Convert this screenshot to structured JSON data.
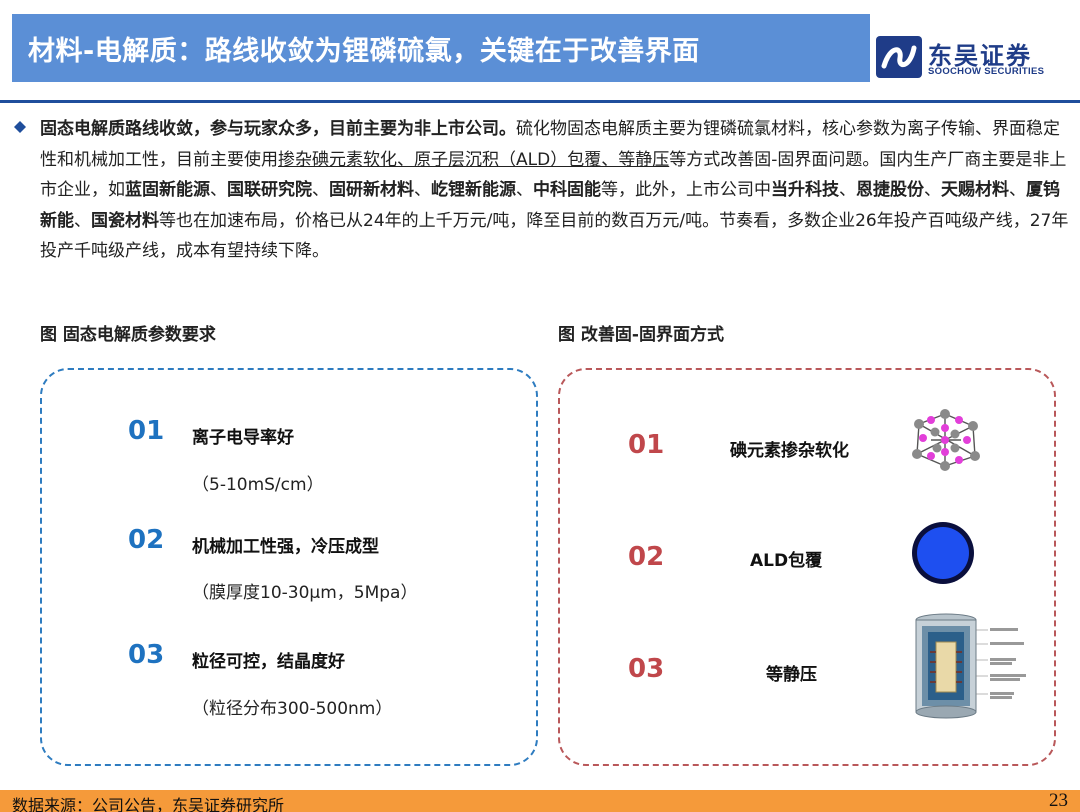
{
  "header": {
    "title": "材料-电解质：路线收敛为锂磷硫氯，关键在于改善界面",
    "logo_cn": "东吴证券",
    "logo_en": "SOOCHOW SECURITIES"
  },
  "summary": {
    "lead_bold": "固态电解质路线收敛，参与玩家众多，目前主要为非上市公司。",
    "text1": "硫化物固态电解质主要为锂磷硫氯材料，核心参数为离子传输、界面稳定性和机械加工性，目前主要使用",
    "underlined": "掺杂碘元素软化、原子层沉积（ALD）包覆、等静压",
    "text2": "等方式改善固-固界面问题。国内生产厂商主要是非上市企业，如",
    "private_companies": [
      "蓝固新能源",
      "国联研究院",
      "固研新材料",
      "屹锂新能源",
      "中科固能"
    ],
    "sep": "、",
    "text3": "等，此外，上市公司中",
    "listed_companies": [
      "当升科技",
      "恩捷股份",
      "天赐材料",
      "厦钨新能",
      "国瓷材料"
    ],
    "text4": "等也在加速布局，价格已从24年的上千万元/吨，降至目前的数百万元/吨。节奏看，多数企业26年投产百吨级产线，27年投产千吨级产线，成本有望持续下降。"
  },
  "figure_left": {
    "caption": "图 固态电解质参数要求",
    "items": [
      {
        "num": "01",
        "title": "离子电导率好",
        "sub": "（5-10mS/cm）"
      },
      {
        "num": "02",
        "title": "机械加工性强，冷压成型",
        "sub": "（膜厚度10-30μm，5Mpa）"
      },
      {
        "num": "03",
        "title": "粒径可控，结晶度好",
        "sub": "（粒径分布300-500nm）"
      }
    ]
  },
  "figure_right": {
    "caption": "图 改善固-固界面方式",
    "items": [
      {
        "num": "01",
        "title": "碘元素掺杂软化"
      },
      {
        "num": "02",
        "title": "ALD包覆"
      },
      {
        "num": "03",
        "title": "等静压"
      }
    ]
  },
  "footer": {
    "source": "数据来源：公司公告，东吴证券研究所",
    "page": "23"
  },
  "colors": {
    "title_bar": "#5b8fd6",
    "brand_blue": "#1f3c88",
    "left_accent": "#1e72c0",
    "right_accent": "#c0474b",
    "footer_bar": "#f59a3a"
  }
}
